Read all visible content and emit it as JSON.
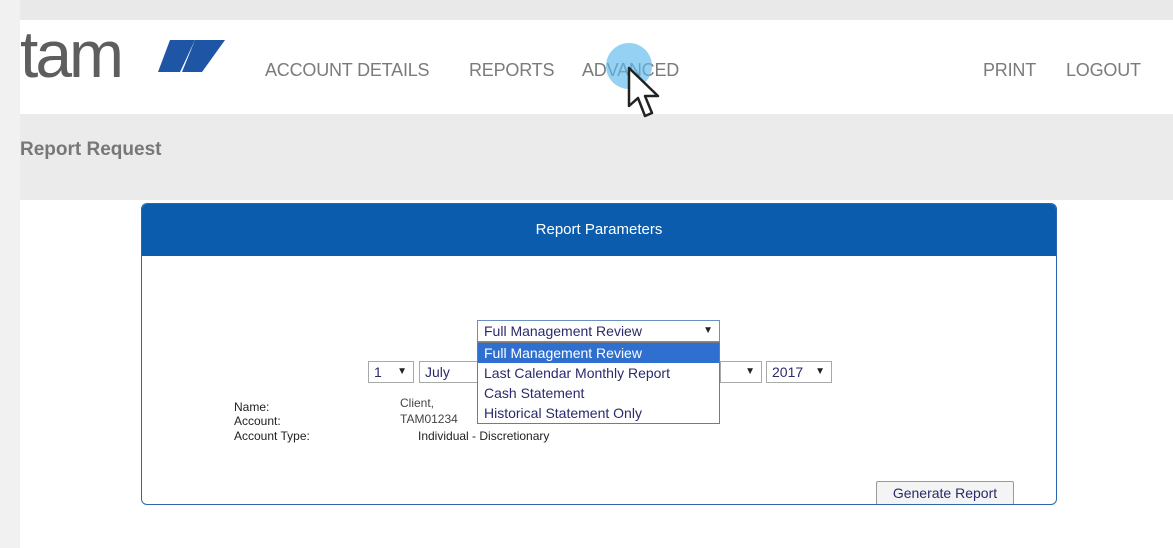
{
  "brand": {
    "logo_text": "tam",
    "logo_color": "#5e5e5e",
    "accent_color": "#1f55a5"
  },
  "nav": {
    "items": [
      {
        "label": "ACCOUNT DETAILS"
      },
      {
        "label": "REPORTS"
      },
      {
        "label": "ADVANCED"
      }
    ],
    "right_items": [
      {
        "label": "PRINT"
      },
      {
        "label": "LOGOUT"
      }
    ]
  },
  "page": {
    "title": "Report Request"
  },
  "panel": {
    "title": "Report Parameters",
    "header_color": "#0b5cad"
  },
  "report_type": {
    "selected": "Full Management Review",
    "options": [
      "Full Management Review",
      "Last Calendar Monthly Report",
      "Cash Statement",
      "Historical Statement Only"
    ],
    "highlighted_index": 0
  },
  "date": {
    "day": "1",
    "month": "July",
    "year": "2017"
  },
  "account": {
    "name_label": "Name:",
    "account_label": "Account:",
    "type_label": "Account Type:",
    "name_value": "Client,",
    "account_value": "TAM01234",
    "type_value": "Individual - Discretionary"
  },
  "actions": {
    "generate_label": "Generate Report"
  },
  "icons": {
    "caret": "▼",
    "cursor": "pointer-arrow-icon"
  }
}
